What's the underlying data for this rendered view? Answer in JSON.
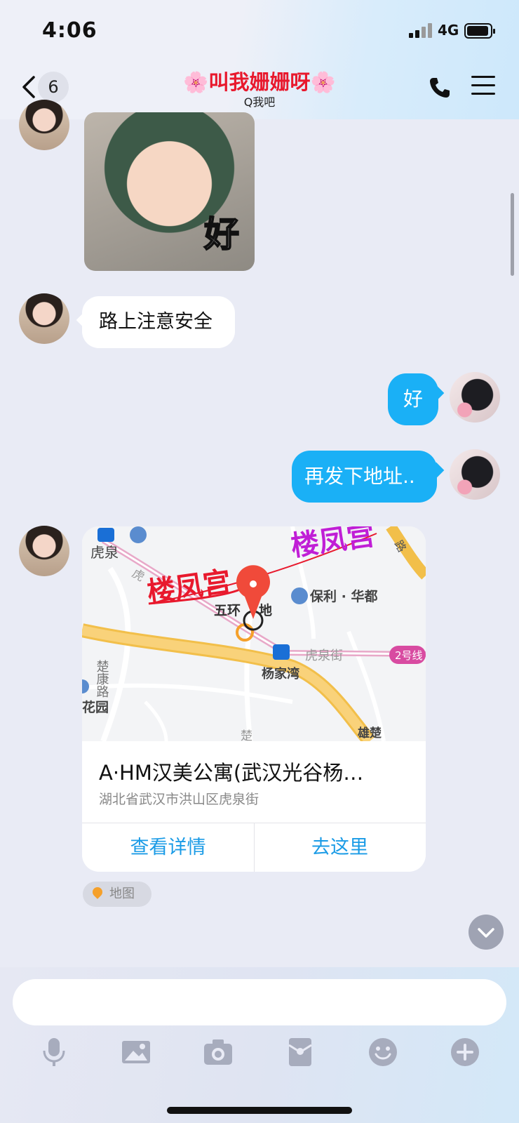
{
  "status_bar": {
    "time": "4:06",
    "network": "4G"
  },
  "header": {
    "back_count": "6",
    "title": "🌸叫我姗姗呀🌸",
    "subtitle": "Q我吧",
    "title_color": "#e8192d"
  },
  "messages": {
    "sticker_text": "好",
    "incoming_1": "路上注意安全",
    "outgoing_1": "好",
    "outgoing_2": "再发下地址..",
    "outgoing_color": "#1ab0f6"
  },
  "map_card": {
    "map_labels": {
      "hand_label_1": "楼凤宫",
      "hand_label_2": "楼凤宫",
      "huquan": "虎泉",
      "poly": "保利 · 华都",
      "wuhuan": "五环",
      "wuhuan_tail": "地",
      "huquanjie": "虎泉街",
      "line2": "2号线",
      "yangjiawan": "杨家湾",
      "chukang": "楚康路",
      "huayuan": "花园",
      "xiong": "雄楚",
      "chu": "楚",
      "road_top": "路",
      "hu_small": "虎"
    },
    "title": "A·HM汉美公寓(武汉光谷杨…",
    "address": "湖北省武汉市洪山区虎泉街",
    "btn_details": "查看详情",
    "btn_go": "去这里",
    "tag": "地图"
  },
  "toolbar": {
    "icons": [
      "microphone-icon",
      "image-icon",
      "camera-icon",
      "red-packet-icon",
      "emoji-icon",
      "plus-icon"
    ]
  }
}
